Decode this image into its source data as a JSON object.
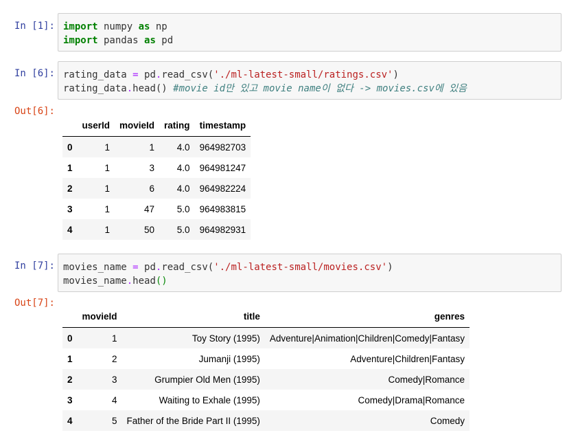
{
  "cells": [
    {
      "prompt": "In [1]:",
      "lines": [
        [
          {
            "t": "import",
            "c": "kw"
          },
          {
            "t": " numpy ",
            "c": ""
          },
          {
            "t": "as",
            "c": "kw"
          },
          {
            "t": " np",
            "c": ""
          }
        ],
        [
          {
            "t": "import",
            "c": "kw"
          },
          {
            "t": " pandas ",
            "c": ""
          },
          {
            "t": "as",
            "c": "kw"
          },
          {
            "t": " pd",
            "c": ""
          }
        ]
      ]
    },
    {
      "prompt": "In [6]:",
      "lines": [
        [
          {
            "t": "rating_data ",
            "c": ""
          },
          {
            "t": "=",
            "c": "op"
          },
          {
            "t": " pd",
            "c": ""
          },
          {
            "t": ".",
            "c": "op"
          },
          {
            "t": "read_csv(",
            "c": ""
          },
          {
            "t": "'./ml-latest-small/ratings.csv'",
            "c": "str"
          },
          {
            "t": ")",
            "c": ""
          }
        ],
        [
          {
            "t": "rating_data",
            "c": ""
          },
          {
            "t": ".",
            "c": "op"
          },
          {
            "t": "head() ",
            "c": ""
          },
          {
            "t": "#movie id만 있고 movie name이 없다 -> movies.csv에 있음",
            "c": "cm"
          }
        ]
      ],
      "out_prompt": "Out[6]:",
      "table": {
        "columns": [
          "",
          "userId",
          "movieId",
          "rating",
          "timestamp"
        ],
        "rows": [
          [
            "0",
            "1",
            "1",
            "4.0",
            "964982703"
          ],
          [
            "1",
            "1",
            "3",
            "4.0",
            "964981247"
          ],
          [
            "2",
            "1",
            "6",
            "4.0",
            "964982224"
          ],
          [
            "3",
            "1",
            "47",
            "5.0",
            "964983815"
          ],
          [
            "4",
            "1",
            "50",
            "5.0",
            "964982931"
          ]
        ]
      }
    },
    {
      "prompt": "In [7]:",
      "lines": [
        [
          {
            "t": "movies_name ",
            "c": ""
          },
          {
            "t": "=",
            "c": "op"
          },
          {
            "t": " pd",
            "c": ""
          },
          {
            "t": ".",
            "c": "op"
          },
          {
            "t": "read_csv(",
            "c": ""
          },
          {
            "t": "'./ml-latest-small/movies.csv'",
            "c": "str"
          },
          {
            "t": ")",
            "c": ""
          }
        ],
        [
          {
            "t": "movies_name",
            "c": ""
          },
          {
            "t": ".",
            "c": "op"
          },
          {
            "t": "head",
            "c": ""
          },
          {
            "t": "()",
            "c": "par-g"
          }
        ]
      ],
      "out_prompt": "Out[7]:",
      "table": {
        "columns": [
          "",
          "movieId",
          "title",
          "genres"
        ],
        "rows": [
          [
            "0",
            "1",
            "Toy Story (1995)",
            "Adventure|Animation|Children|Comedy|Fantasy"
          ],
          [
            "1",
            "2",
            "Jumanji (1995)",
            "Adventure|Children|Fantasy"
          ],
          [
            "2",
            "3",
            "Grumpier Old Men (1995)",
            "Comedy|Romance"
          ],
          [
            "3",
            "4",
            "Waiting to Exhale (1995)",
            "Comedy|Drama|Romance"
          ],
          [
            "4",
            "5",
            "Father of the Bride Part II (1995)",
            "Comedy"
          ]
        ]
      }
    }
  ]
}
